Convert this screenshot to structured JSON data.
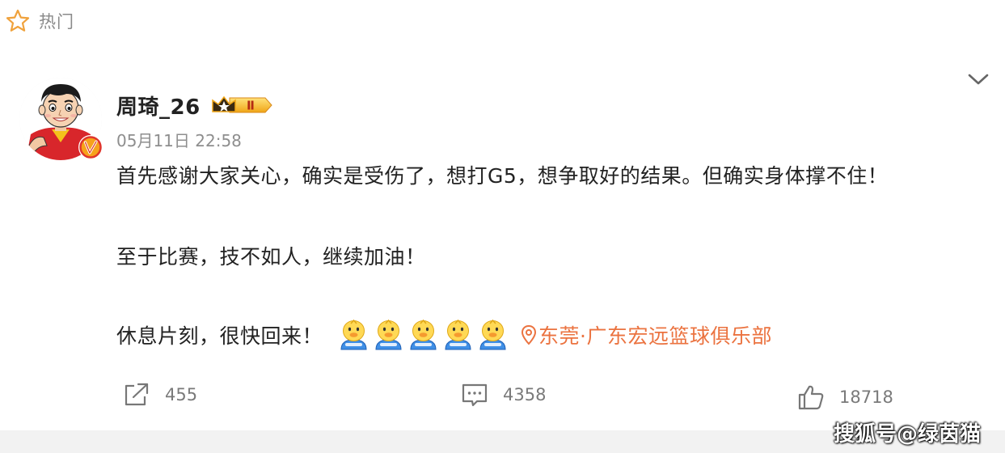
{
  "header": {
    "icon": "star-outline-icon",
    "label": "热门"
  },
  "post": {
    "author": {
      "name": "周琦_26",
      "avatar_icon": "cartoon-avatar",
      "verified_icon": "verified-v-icon",
      "level_badge": "Ⅱ"
    },
    "time": "05月11日 22:58",
    "lines": [
      "首先感谢大家关心，确实是受伤了，想打G5，想争取好的结果。但确实身体撑不住！",
      "至于比赛，技不如人，继续加油！",
      "休息片刻，很快回来！"
    ],
    "emoji_count": 5,
    "location": {
      "icon": "location-pin-icon",
      "label": "东莞·广东宏远篮球俱乐部"
    },
    "actions": {
      "repost": {
        "icon": "share-icon",
        "count": "455"
      },
      "comment": {
        "icon": "comment-icon",
        "count": "4358"
      },
      "like": {
        "icon": "thumbs-up-icon",
        "count": "18718"
      }
    }
  },
  "watermark": "搜狐号@绿茵猫",
  "colors": {
    "location": "#eb7340",
    "muted_text": "#8e8e8e",
    "badge_gold": "#f5c342"
  }
}
